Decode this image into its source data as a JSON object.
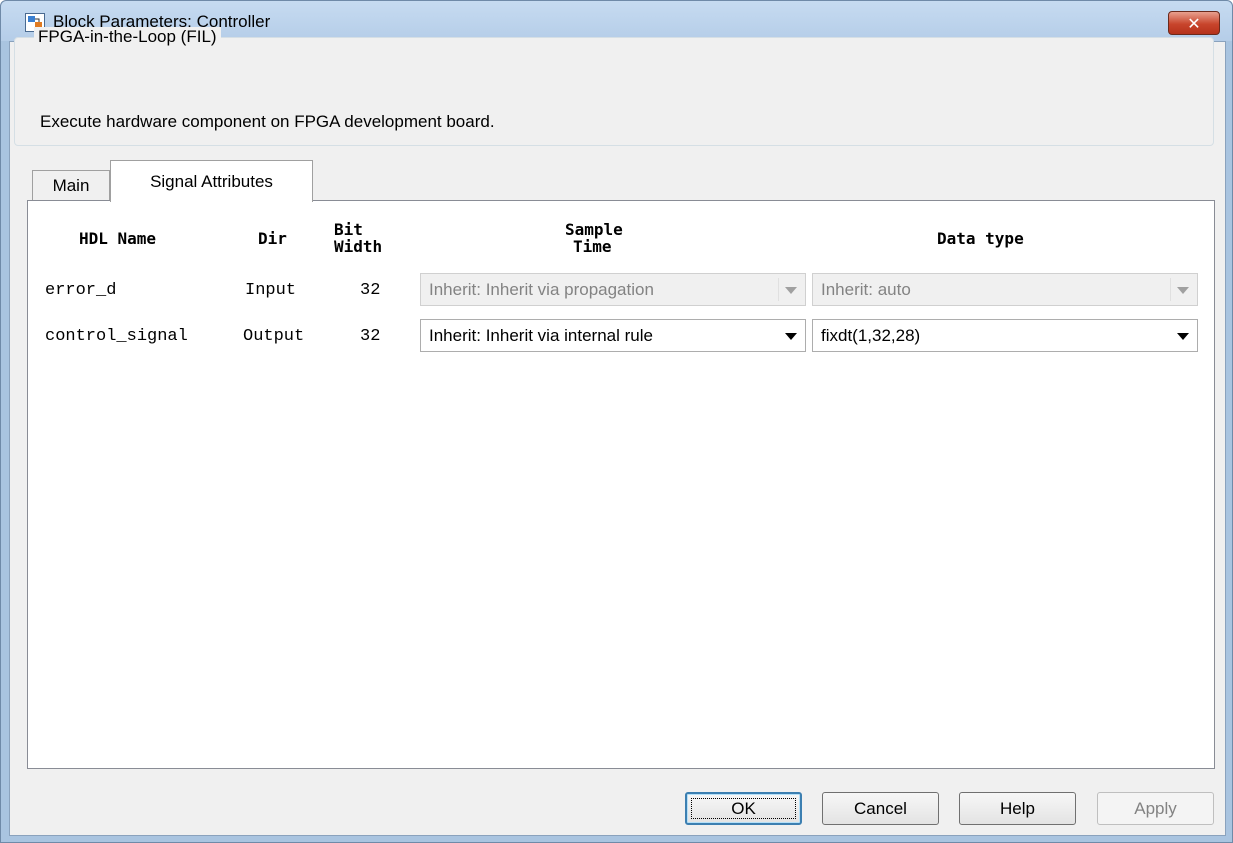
{
  "window": {
    "title": "Block Parameters: Controller",
    "close_icon": "close-icon",
    "app_icon": "simulink-block-icon"
  },
  "group": {
    "title": "FPGA-in-the-Loop (FIL)",
    "description": "Execute hardware component on FPGA development board."
  },
  "tabs": [
    {
      "label": "Main",
      "active": false
    },
    {
      "label": "Signal Attributes",
      "active": true
    }
  ],
  "table": {
    "headers": {
      "hdl_name": "HDL Name",
      "dir": "Dir",
      "bit_width_1": "Bit",
      "bit_width_2": "Width",
      "sample_time_1": "Sample",
      "sample_time_2": "Time",
      "data_type": "Data type"
    },
    "rows": [
      {
        "hdl_name": "error_d",
        "dir": "Input",
        "bit_width": "32",
        "sample_time": "Inherit: Inherit via propagation",
        "data_type": "Inherit: auto",
        "enabled": false
      },
      {
        "hdl_name": "control_signal",
        "dir": "Output",
        "bit_width": "32",
        "sample_time": "Inherit: Inherit via internal rule",
        "data_type": "fixdt(1,32,28)",
        "enabled": true
      }
    ]
  },
  "buttons": {
    "ok": "OK",
    "cancel": "Cancel",
    "help": "Help",
    "apply": "Apply"
  }
}
